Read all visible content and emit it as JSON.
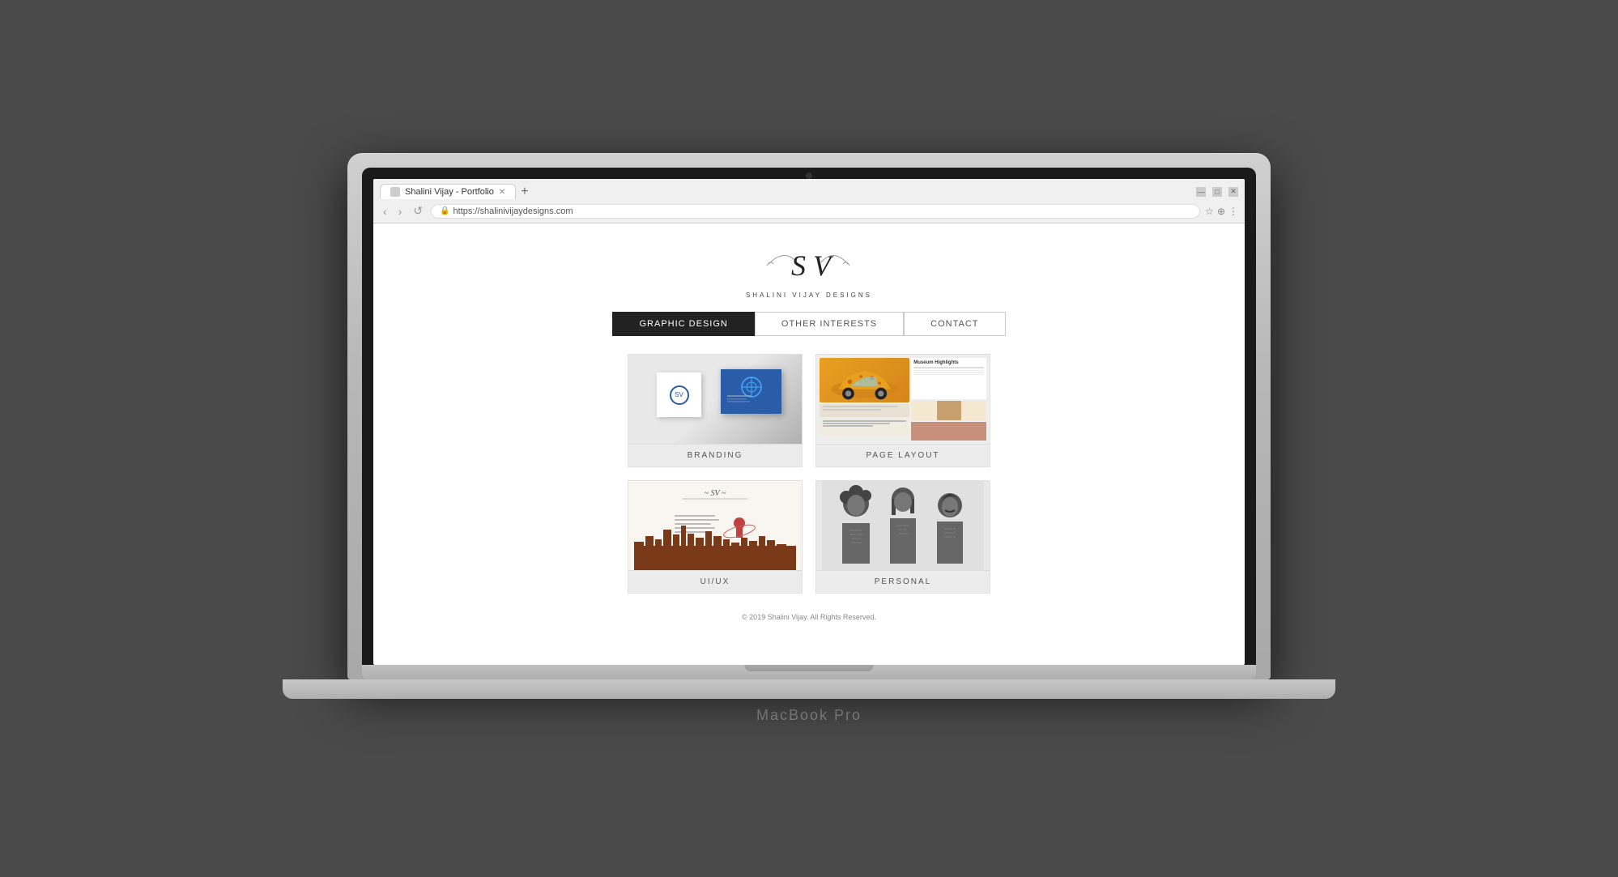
{
  "macbook": {
    "label": "MacBook Pro"
  },
  "browser": {
    "tab_title": "Shalini Vijay - Portfolio",
    "url": "https://shalinivijaydesigns.com",
    "nav_back": "‹",
    "nav_forward": "›",
    "nav_refresh": "↺",
    "new_tab": "+"
  },
  "site": {
    "logo_text": "SV",
    "brand_name": "SHALINI VIJAY DESIGNS",
    "nav": {
      "graphic_design": "GRAPHIC DESIGN",
      "other_interests": "OTHER INTERESTS",
      "contact": "CONTACT"
    },
    "portfolio": [
      {
        "id": "branding",
        "label": "BRANDING"
      },
      {
        "id": "page-layout",
        "label": "PAGE LAYOUT"
      },
      {
        "id": "uiux",
        "label": "UI/UX"
      },
      {
        "id": "personal",
        "label": "PERSONAL"
      }
    ],
    "footer": "© 2019 Shalini Vijay. All Rights Reserved."
  }
}
